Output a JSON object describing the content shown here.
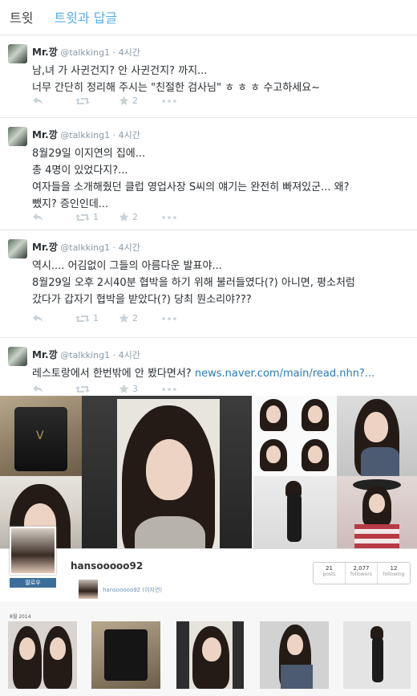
{
  "tabs": [
    {
      "label": "트윗",
      "active": false
    },
    {
      "label": "트윗과 답글",
      "active": true
    }
  ],
  "tweets": [
    {
      "name": "Mr.깡",
      "handle": "@talkking1",
      "time": "4시간",
      "lines": [
        "남,녀 가 사귄건지? 안 사귄건지? 까지...",
        "너무 간단히 정리해 주시는 \"친절한 검사님\" ㅎ ㅎ ㅎ 수고하세요~"
      ],
      "link": "",
      "retweets": "",
      "favorites": "2"
    },
    {
      "name": "Mr.깡",
      "handle": "@talkking1",
      "time": "4시간",
      "lines": [
        "8월29일 이지연의 집에...",
        "총 4명이 있었다지?...",
        "여자들을 소개해줬던 클럽 영업사장 S씨의 얘기는 완전히 빠져있군... 왜?",
        "뺐지? 증인인데..."
      ],
      "link": "",
      "retweets": "1",
      "favorites": "2"
    },
    {
      "name": "Mr.깡",
      "handle": "@talkking1",
      "time": "4시간",
      "lines": [
        "역시.... 어김없이 그들의 아름다운 발표야...",
        "8월29일 오후 2시40분 협박을 하기 위해 불러들였다(?) 아니면, 평소처럼",
        "갔다가 갑자기 협박을 받았다(?) 당최 뭔소리야???"
      ],
      "link": "",
      "retweets": "1",
      "favorites": "2"
    },
    {
      "name": "Mr.깡",
      "handle": "@talkking1",
      "time": "4시간",
      "lines": [
        "레스토랑에서 한번밖에 안 봤다면서? "
      ],
      "link": "news.naver.com/main/read.nhn?...",
      "retweets": "",
      "favorites": "3"
    }
  ],
  "instagram": {
    "username": "hansooooo92",
    "follow_badge": "팔로우",
    "mini_caption": "hansooooo92 (이지연)",
    "stats": [
      {
        "value": "21",
        "label": "posts"
      },
      {
        "value": "2,077",
        "label": "followers"
      },
      {
        "value": "12",
        "label": "following"
      }
    ],
    "date_label": "8월 2014"
  },
  "icons": [
    "reply-icon",
    "retweet-icon",
    "favorite-icon",
    "more-icon"
  ],
  "colors": {
    "accent": "#55acee",
    "link": "#2b7bb9",
    "muted": "#8899a6"
  }
}
